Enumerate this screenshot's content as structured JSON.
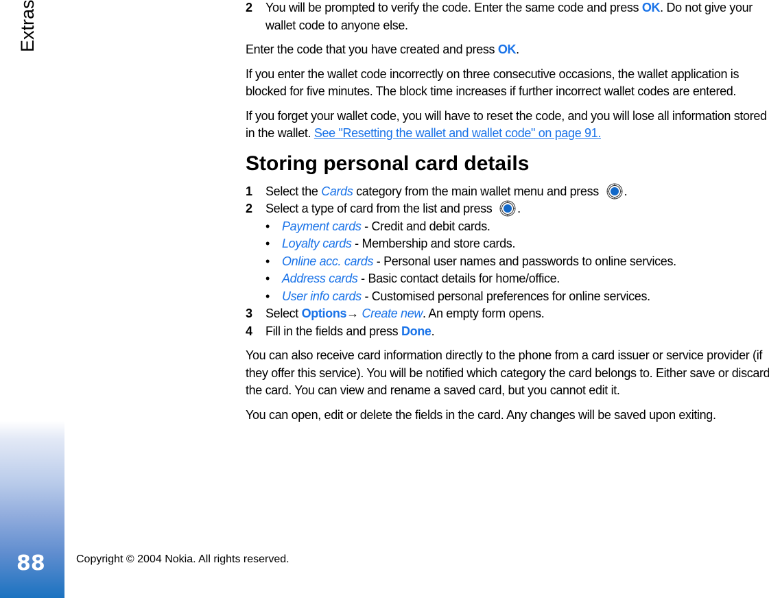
{
  "sidebar": {
    "section_title": "Extras",
    "page_number": "88",
    "accent_color": "#1b72c0"
  },
  "footer": {
    "copyright": "Copyright © 2004 Nokia. All rights reserved."
  },
  "top_step": {
    "number": "2",
    "text_a": "You will be prompted to verify the code. Enter the same code and press ",
    "ok": "OK",
    "text_b": ". Do not give your wallet code to anyone else."
  },
  "para_enter": {
    "text_a": "Enter the code that you have created and press ",
    "ok": "OK",
    "text_b": "."
  },
  "para_blocked": "If you enter the wallet code incorrectly on three consecutive occasions, the wallet application is blocked for five minutes. The block time increases if further incorrect wallet codes are entered.",
  "para_forget": {
    "text": "If you forget your wallet code, you will have to reset the code, and you will lose all information stored in the wallet. ",
    "link": "See \"Resetting the wallet and wallet code\" on page 91."
  },
  "section": {
    "heading": "Storing personal card details",
    "steps": [
      {
        "number": "1",
        "text_a": "Select the ",
        "italic": "Cards",
        "text_b": " category from the main wallet menu and press ",
        "icon": "select-key-icon",
        "text_c": "."
      },
      {
        "number": "2",
        "text_a": "Select a type of card from the list and press ",
        "icon": "select-key-icon",
        "text_b": "."
      },
      {
        "number": "3",
        "text_a": "Select ",
        "bold": "Options",
        "arrow": "→ ",
        "italic": "Create new",
        "text_b": ". An empty form opens."
      },
      {
        "number": "4",
        "text_a": "Fill in the fields and press ",
        "bold": "Done",
        "text_b": "."
      }
    ],
    "card_types": [
      {
        "name": "Payment cards",
        "desc": " - Credit and debit cards."
      },
      {
        "name": "Loyalty cards",
        "desc": " - Membership and store cards."
      },
      {
        "name": "Online acc. cards",
        "desc": " - Personal user names and passwords to online services."
      },
      {
        "name": "Address cards",
        "desc": " - Basic contact details for home/office."
      },
      {
        "name": "User info cards",
        "desc": " - Customised personal preferences for online services."
      }
    ],
    "para_receive": "You can also receive card information directly to the phone from a card issuer or service provider (if they offer this service). You will be notified which category the card belongs to. Either save or discard the card. You can view and rename a saved card, but you cannot edit it.",
    "para_edit": "You can open, edit or delete the fields in the card. Any changes will be saved upon exiting."
  }
}
